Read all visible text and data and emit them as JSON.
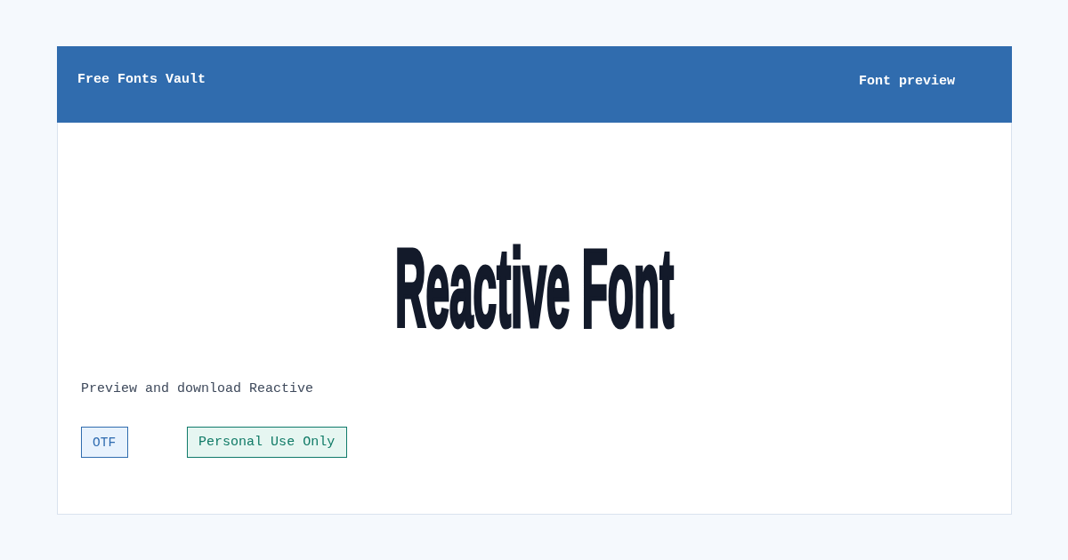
{
  "header": {
    "brand": "Free Fonts Vault",
    "page_label": "Font preview"
  },
  "preview": {
    "sample_text": "Reactive Font",
    "description": "Preview and download Reactive"
  },
  "tags": [
    {
      "label": "OTF",
      "kind": "format"
    },
    {
      "label": "Personal Use Only",
      "kind": "license"
    }
  ]
}
